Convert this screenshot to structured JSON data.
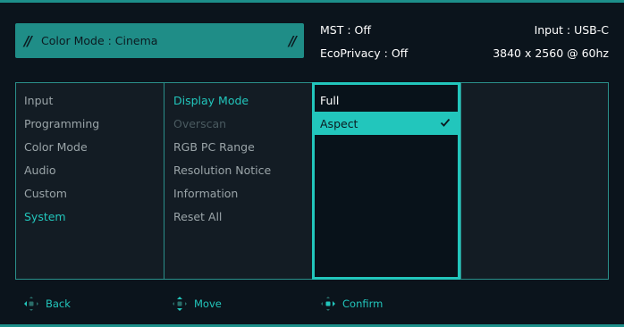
{
  "header": {
    "mode_label": "Color Mode : Cinema",
    "mst": "MST : Off",
    "input": "Input : USB-C",
    "ecoprivacy": "EcoPrivacy : Off",
    "resolution": "3840 x 2560 @ 60hz"
  },
  "menu": {
    "main_items": [
      "Input",
      "Programming",
      "Color Mode",
      "Audio",
      "Custom",
      "System"
    ],
    "sub_items": [
      "Display Mode",
      "Overscan",
      "RGB PC Range",
      "Resolution Notice",
      "Information",
      "Reset All"
    ],
    "options": [
      "Full",
      "Aspect"
    ]
  },
  "nav": {
    "back": "Back",
    "move": "Move",
    "confirm": "Confirm"
  },
  "colors": {
    "accent": "#22c6bc",
    "banner": "#1f8d87",
    "bg": "#0b141c"
  }
}
